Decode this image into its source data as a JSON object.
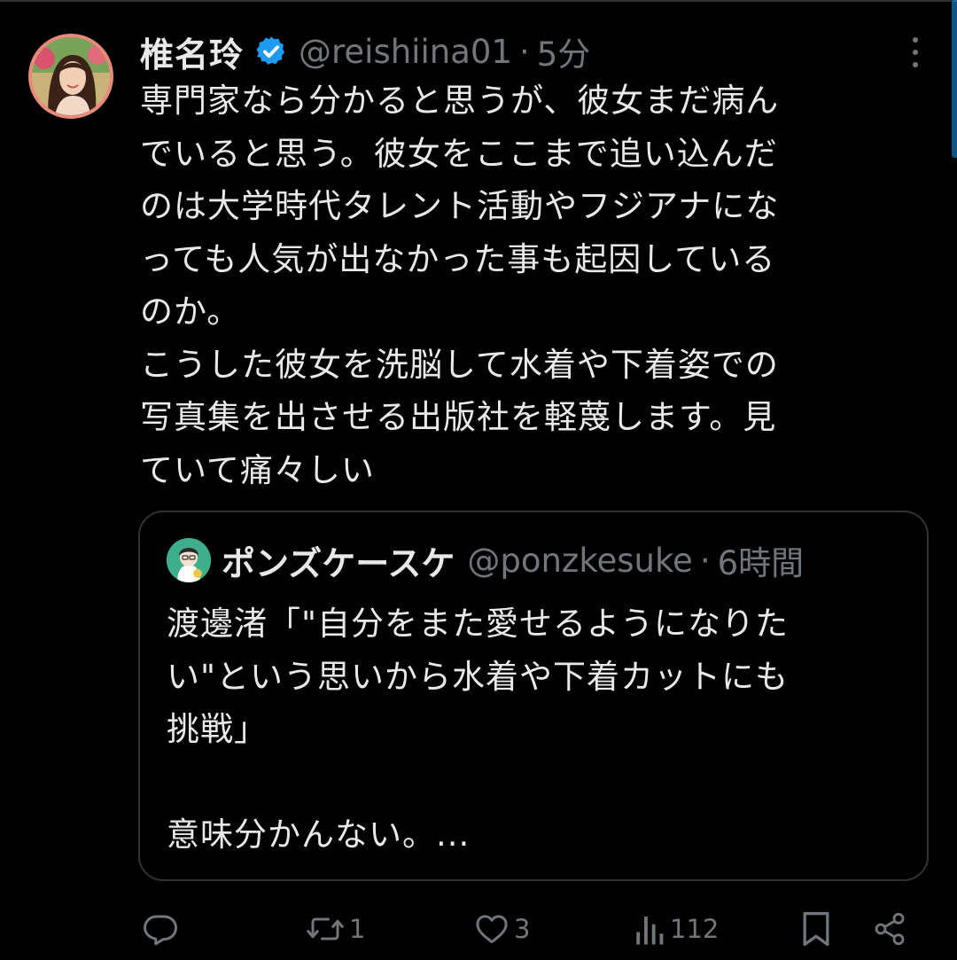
{
  "tweet": {
    "display_name": "椎名玲",
    "handle": "@reishiina01",
    "separator": "·",
    "time": "5分",
    "verified": true,
    "body": "専門家なら分かると思うが、彼女まだ病ん\nでいると思う。彼女をここまで追い込んだ\nのは大学時代タレント活動やフジアナにな\nっても人気が出なかった事も起因している\nのか。\nこうした彼女を洗脳して水着や下着姿での\n写真集を出させる出版社を軽蔑します。見\nていて痛々しい"
  },
  "quote": {
    "display_name": "ポンズケースケ",
    "handle": "@ponzkesuke",
    "separator": "·",
    "time": "6時間",
    "body": "渡邊渚「\"自分をまた愛せるようになりた\nい\"という思いから水着や下着カットにも\n挑戦」\n\n意味分かんない。..."
  },
  "actions": {
    "reply_icon": "reply-icon",
    "retweet_icon": "retweet-icon",
    "retweet_count": "1",
    "like_icon": "heart-icon",
    "like_count": "3",
    "views_icon": "bar-chart-icon",
    "views_count": "112",
    "bookmark_icon": "bookmark-icon",
    "share_icon": "share-icon"
  },
  "colors": {
    "background": "#000000",
    "text_primary": "#e7e9ea",
    "text_secondary": "#71767b",
    "border": "#2f3336",
    "verified_blue": "#1d9bf0"
  }
}
